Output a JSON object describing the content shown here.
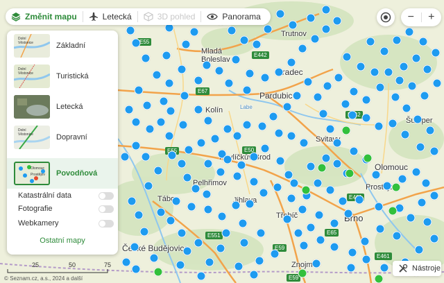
{
  "topbar": {
    "change_map": "Změnit mapu",
    "aerial": "Letecká",
    "view3d": "3D pohled",
    "panorama": "Panorama"
  },
  "zoom": {
    "plus": "+",
    "minus": "−"
  },
  "layers": {
    "items": [
      {
        "label": "Základní",
        "thumb_text": "Dolní Věstonice"
      },
      {
        "label": "Turistická",
        "thumb_text": "Dolní Věstonice"
      },
      {
        "label": "Letecká"
      },
      {
        "label": "Dopravní",
        "thumb_text": "Dolní Věstonice"
      },
      {
        "label": "Povodňová",
        "thumb_text": "Olomouc Prostějov"
      }
    ],
    "toggles": [
      {
        "label": "Katastrální data"
      },
      {
        "label": "Fotografie"
      },
      {
        "label": "Webkamery"
      }
    ],
    "more": "Ostatní mapy"
  },
  "tools": {
    "label": "Nástroje"
  },
  "scale": {
    "ticks": [
      "25",
      "50",
      "75"
    ]
  },
  "copyright": "© Seznam.cz, a.s., 2024 a další",
  "places": {
    "mlada_boleslav": "Mladá\nBoleslav",
    "hradec": "Hradec",
    "pardubice": "Pardubice",
    "kolin": "Kolín",
    "svitavy": "Svitavy",
    "olomouc": "Olomouc",
    "prostejov": "Prostějov",
    "havlickuv_brod": "Havlíčkův Brod",
    "pelhrimov": "Pelhřimov",
    "jihlava": "Jihlava",
    "tabor": "Tábor",
    "trebic": "Třebíč",
    "brno": "Brno",
    "ceske_budejovice": "České Budějovice",
    "znojmo": "Znojmo",
    "sumperk": "Šumper",
    "trutnov": "Trutnov",
    "labe": "Labe"
  },
  "roads": [
    "E442",
    "E55",
    "E67",
    "E442",
    "E55",
    "E50",
    "E461",
    "E551",
    "E59",
    "E65",
    "E461",
    "E59"
  ],
  "colors": {
    "blue_marker": "#1e9bf0",
    "green_marker": "#32c03c",
    "brand_green": "#2e8b3a"
  }
}
